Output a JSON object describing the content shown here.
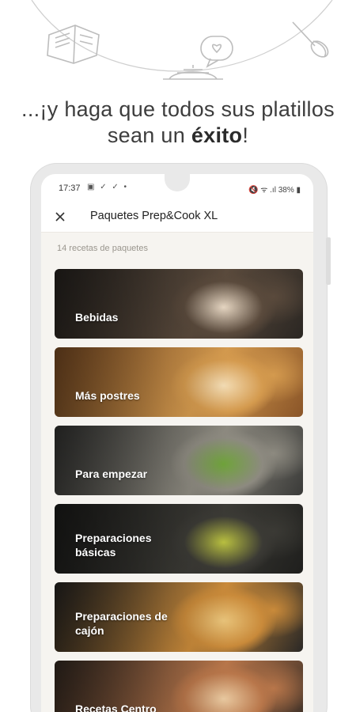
{
  "headline": {
    "line1": "...¡y haga que todos sus platillos",
    "line2_prefix": "sean un ",
    "line2_bold": "éxito",
    "line2_suffix": "!"
  },
  "statusbar": {
    "time": "17:37",
    "icons_left": "▣ ✓ ✓ •",
    "right": "🔇 ᯤ .ıl 38% ▮"
  },
  "appbar": {
    "title": "Paquetes Prep&Cook XL",
    "close_icon": "close-icon"
  },
  "subtitle": "14 recetas de paquetes",
  "cards": [
    {
      "label": "Bebidas",
      "colors": [
        "#2b2723",
        "#5a4a3c",
        "#e6d6c2"
      ]
    },
    {
      "label": "Más postres",
      "colors": [
        "#8a5528",
        "#d49a4e",
        "#f3dcb4"
      ]
    },
    {
      "label": "Para empezar",
      "colors": [
        "#3a3a38",
        "#8d8a80",
        "#6fa33a"
      ]
    },
    {
      "label": "Preparaciones básicas",
      "colors": [
        "#1f1f1d",
        "#3b3a35",
        "#b9c040"
      ]
    },
    {
      "label": "Preparaciones de cajón",
      "colors": [
        "#2a2826",
        "#c98a3a",
        "#e8c37a"
      ]
    },
    {
      "label": "Recetas Centro",
      "colors": [
        "#3a2e26",
        "#b8764a",
        "#e9c9a0"
      ]
    }
  ]
}
